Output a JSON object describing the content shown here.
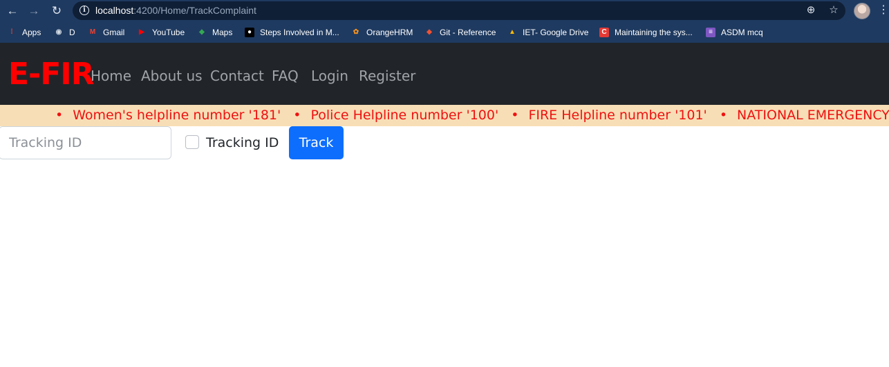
{
  "browser": {
    "url_host": "localhost",
    "url_rest": ":4200/Home/TrackComplaint",
    "bookmarks": [
      {
        "label": "Apps",
        "icon": "apps-grid-icon",
        "color": "#ea4335"
      },
      {
        "label": "D",
        "icon": "globe-icon",
        "color": "#cfd8e3"
      },
      {
        "label": "Gmail",
        "icon": "gmail-icon",
        "color": "#ea4335"
      },
      {
        "label": "YouTube",
        "icon": "youtube-icon",
        "color": "#ff0000"
      },
      {
        "label": "Maps",
        "icon": "maps-icon",
        "color": "#34a853"
      },
      {
        "label": "Steps Involved in M...",
        "icon": "medium-icon",
        "color": "#000000"
      },
      {
        "label": "OrangeHRM",
        "icon": "orangehrm-icon",
        "color": "#f7931e"
      },
      {
        "label": "Git - Reference",
        "icon": "git-icon",
        "color": "#f05133"
      },
      {
        "label": "IET- Google Drive",
        "icon": "google-drive-icon",
        "color": "#fbbc04"
      },
      {
        "label": "Maintaining the sys...",
        "icon": "c-icon",
        "color": "#e53935"
      },
      {
        "label": "ASDM mcq",
        "icon": "forms-icon",
        "color": "#7e57c2"
      }
    ]
  },
  "navbar": {
    "brand": "E-FIR",
    "links": [
      "Home",
      "About us",
      "Contact",
      "FAQ",
      "Login",
      "Register"
    ]
  },
  "ticker": {
    "items": [
      "Women's helpline number '181'",
      "Police Helpline number '100'",
      "FIRE Helpline number '101'",
      "NATIONAL EMERGENCY NUMBER"
    ]
  },
  "form": {
    "tracking_placeholder": "Tracking ID",
    "tracking_value": "",
    "checkbox_label": "Tracking ID",
    "checkbox_checked": false,
    "track_button": "Track"
  },
  "colors": {
    "brand": "#ff0000",
    "navbar_bg": "#212529",
    "ticker_bg": "#f8deb6",
    "ticker_text": "#ee1111",
    "button_primary": "#0d6efd"
  }
}
